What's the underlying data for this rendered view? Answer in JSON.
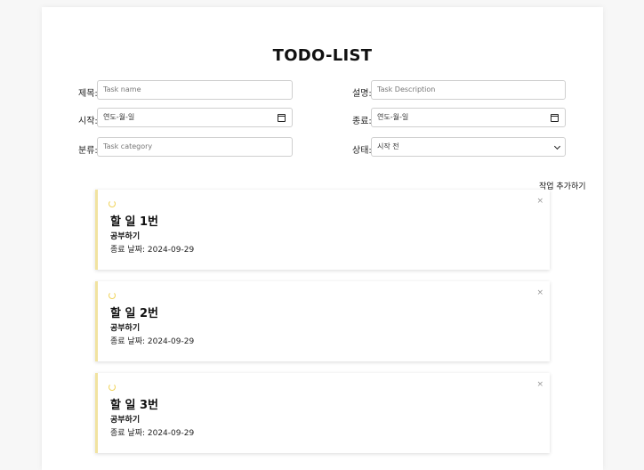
{
  "page": {
    "title": "TODO-LIST"
  },
  "form": {
    "title_label": "제목:",
    "title_placeholder": "Task name",
    "description_label": "설명:",
    "description_placeholder": "Task Description",
    "start_label": "시작:",
    "start_value": "연도-월-일",
    "end_label": "종료:",
    "end_value": "연도-월-일",
    "category_label": "분류:",
    "category_placeholder": "Task category",
    "status_label": "상태:",
    "status_value": "시작 전",
    "add_button": "작업 추가하기"
  },
  "tasks": [
    {
      "title": "할 일 1번",
      "description": "공부하기",
      "end_date": "종료 날짜: 2024-09-29",
      "close": "×"
    },
    {
      "title": "할 일 2번",
      "description": "공부하기",
      "end_date": "종료 날짜: 2024-09-29",
      "close": "×"
    },
    {
      "title": "할 일 3번",
      "description": "공부하기",
      "end_date": "종료 날짜: 2024-09-29",
      "close": "×"
    }
  ],
  "colors": {
    "accent_border": "#f1e3a0",
    "spinner": "#f0d35a"
  }
}
